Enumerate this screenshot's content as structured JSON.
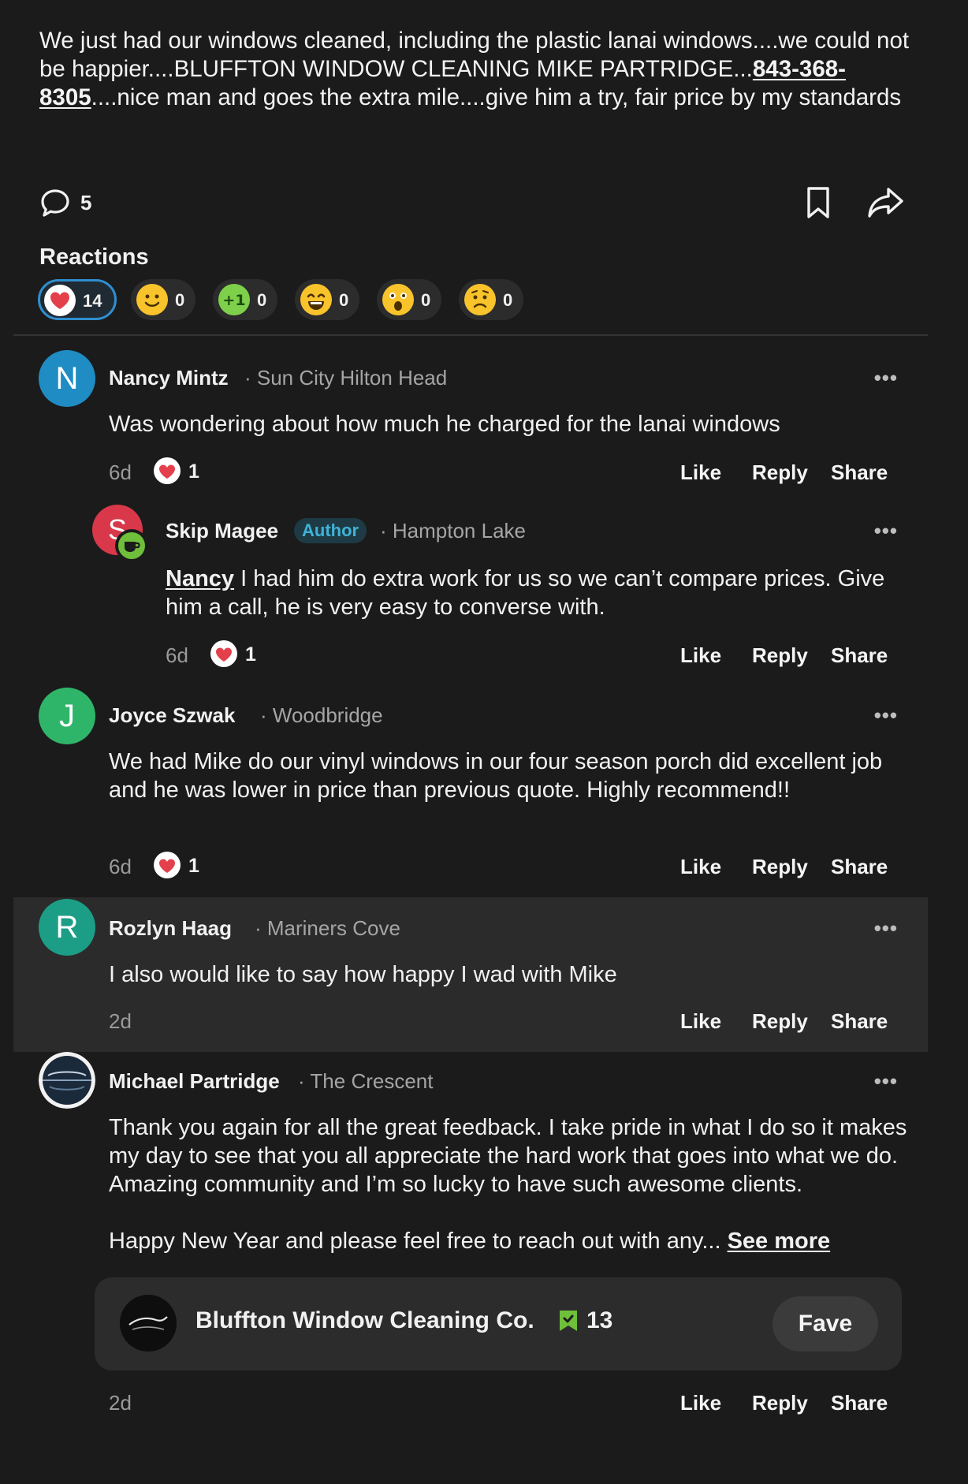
{
  "post": {
    "text_before_phone": "We just had our windows cleaned, including the plastic lanai windows....we could not be happier....BLUFFTON WINDOW CLEANING MIKE PARTRIDGE...",
    "phone": "843-368-8305",
    "text_after_phone": "....nice man and goes the extra mile....give him a try, fair price by my standards",
    "comment_count": "5"
  },
  "reactions": {
    "title": "Reactions",
    "items": [
      {
        "icon": "heart-icon",
        "count": "14",
        "selected": true
      },
      {
        "icon": "smile-emoji-icon",
        "count": "0"
      },
      {
        "icon": "plus-one-icon",
        "count": "0"
      },
      {
        "icon": "laugh-emoji-icon",
        "count": "0"
      },
      {
        "icon": "surprised-emoji-icon",
        "count": "0"
      },
      {
        "icon": "sad-emoji-icon",
        "count": "0"
      }
    ]
  },
  "actions": {
    "like": "Like",
    "reply": "Reply",
    "share": "Share",
    "more": "•••"
  },
  "comments": [
    {
      "initial": "N",
      "name": "Nancy Mintz",
      "location": "· Sun City Hilton Head",
      "text": "Was wondering about how much he charged for the lanai windows",
      "time": "6d",
      "hearts": "1",
      "avatar_color": "#1f8cc4"
    },
    {
      "initial": "S",
      "name": "Skip Magee",
      "badge": "Author",
      "location": "· Hampton Lake",
      "mention": "Nancy",
      "text": " I had him do extra work for us so we can’t compare prices. Give him a call, he is very easy to converse with.",
      "time": "6d",
      "hearts": "1",
      "avatar_color": "#d8384a"
    },
    {
      "initial": "J",
      "name": "Joyce Szwak",
      "location": "· Woodbridge",
      "text": "We had Mike do our vinyl windows in our four season porch did excellent job and he was lower in price than previous quote. Highly recommend!!",
      "time": "6d",
      "hearts": "1",
      "avatar_color": "#2fb56a"
    },
    {
      "initial": "R",
      "name": "Rozlyn Haag",
      "location": "· Mariners Cove",
      "text": "I also would like to say how happy I wad with Mike",
      "time": "2d",
      "avatar_color": "#1c9e86"
    },
    {
      "name": "Michael Partridge",
      "location": "· The Crescent",
      "text": "Thank you again for all the great feedback.  I take pride in what I do so it makes my day to see that you all appreciate the hard work that goes into what we do. Amazing community and I’m so lucky to have such awesome clients.",
      "text_line2": "Happy New Year and please feel free to reach out with any...",
      "see_more": "See more",
      "time": "2d"
    }
  ],
  "business": {
    "name": "Bluffton Window Cleaning Co.",
    "fave_count": "13",
    "fave_button": "Fave"
  }
}
